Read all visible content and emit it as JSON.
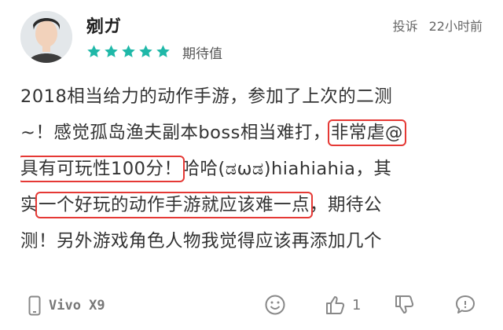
{
  "user": {
    "name": "剜ガ"
  },
  "rating": {
    "stars": 5,
    "label": "期待值",
    "color": "#1fb8a8"
  },
  "header_actions": {
    "report": "投诉",
    "time": "22小时前"
  },
  "review": {
    "lines": [
      {
        "segments": [
          {
            "text": "2018相当给力的动作手游，参加了上次的二测"
          }
        ]
      },
      {
        "segments": [
          {
            "text": "~！感觉孤岛渔夫副本boss相当难打，"
          },
          {
            "text": "非常虐@",
            "highlight": true
          }
        ]
      },
      {
        "segments": [
          {
            "text": "具有可玩性100分！",
            "highlight": true
          },
          {
            "text": "哈哈(ಡωಡ)hiahiahia，其"
          }
        ]
      },
      {
        "segments": [
          {
            "text": "实"
          },
          {
            "text": "一个好玩的动作手游就应该难一点",
            "highlight": true
          },
          {
            "text": "，期待公"
          }
        ]
      },
      {
        "segments": [
          {
            "text": "测！另外游戏角色人物我觉得应该再添加几个"
          }
        ]
      }
    ]
  },
  "footer": {
    "device": "Vivo X9",
    "like_count": "1",
    "highlight_color": "#e53935"
  }
}
